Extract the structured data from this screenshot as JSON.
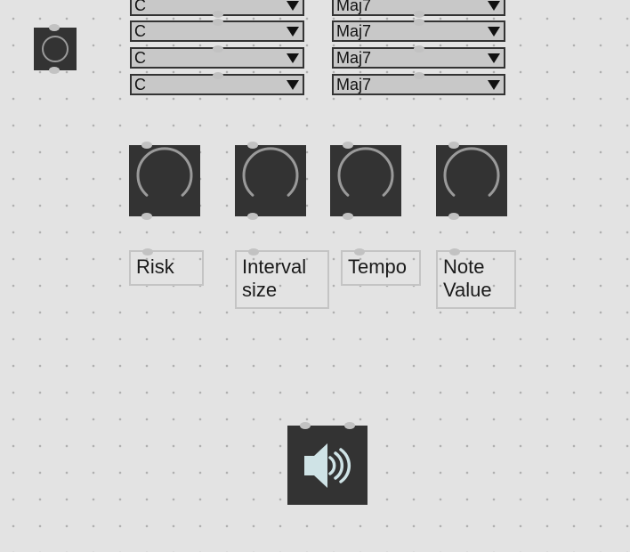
{
  "menus": [
    {
      "note": "C",
      "chord": "Maj7"
    },
    {
      "note": "C",
      "chord": "Maj7"
    },
    {
      "note": "C",
      "chord": "Maj7"
    },
    {
      "note": "C",
      "chord": "Maj7"
    }
  ],
  "dials": [
    {
      "label": "Risk"
    },
    {
      "label": "Interval size"
    },
    {
      "label": "Tempo"
    },
    {
      "label": "Note Value"
    }
  ],
  "colors": {
    "canvas": "#e3e3e3",
    "object_bg": "#333333",
    "menu_bg": "#c8c8c8",
    "dial_arc": "#9a9a9a",
    "speaker": "#cfe3e6"
  },
  "icons": {
    "toggle": "toggle-ring-icon",
    "dial": "dial-arc-icon",
    "audio": "speaker-icon"
  }
}
